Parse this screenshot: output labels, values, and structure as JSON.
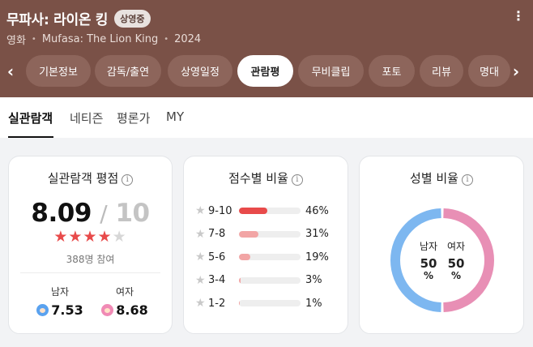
{
  "header": {
    "title": "무파사: 라이온 킹",
    "badge": "상영중",
    "meta": [
      "영화",
      "Mufasa: The Lion King",
      "2024"
    ],
    "more_icon": "more-vertical-icon",
    "colors": {
      "background": "#7a5147",
      "tab": "#8d655b"
    }
  },
  "tabs": [
    {
      "label": "기본정보"
    },
    {
      "label": "감독/출연"
    },
    {
      "label": "상영일정"
    },
    {
      "label": "관람평"
    },
    {
      "label": "무비클립"
    },
    {
      "label": "포토"
    },
    {
      "label": "리뷰"
    },
    {
      "label": "명대"
    }
  ],
  "active_tab": "관람평",
  "subtabs": [
    "실관람객",
    "네티즌",
    "평론가",
    "MY"
  ],
  "active_subtab": "실관람객",
  "rating_card": {
    "title": "실관람객 평점",
    "score": "8.09",
    "slash": "/",
    "max": "10",
    "stars_filled": 4,
    "stars_total": 5,
    "count": "388명 참여",
    "male_label": "남자",
    "male_score": "7.53",
    "female_label": "여자",
    "female_score": "8.68"
  },
  "distribution_card": {
    "title": "점수별 비율",
    "rows": [
      {
        "label": "9-10",
        "pct_text": "46%",
        "value": 46,
        "color": "#e84a4a"
      },
      {
        "label": "7-8",
        "pct_text": "31%",
        "value": 31,
        "color": "#f2a5a5"
      },
      {
        "label": "5-6",
        "pct_text": "19%",
        "value": 19,
        "color": "#f2a5a5"
      },
      {
        "label": "3-4",
        "pct_text": "3%",
        "value": 3,
        "color": "#f2a5a5"
      },
      {
        "label": "1-2",
        "pct_text": "1%",
        "value": 1,
        "color": "#f2a5a5"
      }
    ]
  },
  "gender_card": {
    "title": "성별 비율",
    "male_label": "남자",
    "male_value": "50",
    "female_label": "여자",
    "female_value": "50",
    "unit": "%",
    "male_share": 50,
    "female_share": 50,
    "male_color": "#7db7f0",
    "female_color": "#e88fb5"
  }
}
